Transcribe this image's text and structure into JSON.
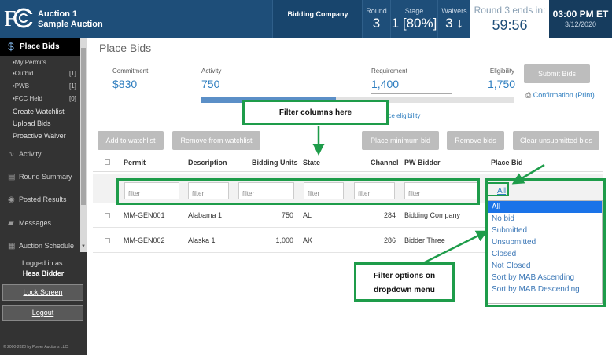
{
  "header": {
    "logo_text": "FCC",
    "auction_line1": "Auction 1",
    "auction_line2": "Sample Auction",
    "company": "Bidding Company",
    "round_label": "Round",
    "round_value": "3",
    "stage_label": "Stage",
    "stage_value": "1 [80%]",
    "waivers_label": "Waivers",
    "waivers_value": "3 ↓",
    "round_ends_label": "Round 3 ends in:",
    "round_ends_value": "59:56",
    "clock_time": "03:00 PM ET",
    "clock_date": "3/12/2020"
  },
  "sidebar": {
    "active_label": "Place Bids",
    "sub_items": [
      {
        "label": "•My Permits",
        "count": ""
      },
      {
        "label": "•Outbid",
        "count": "[1]"
      },
      {
        "label": "•PWB",
        "count": "[1]"
      },
      {
        "label": "•FCC Held",
        "count": "[0]"
      }
    ],
    "links": [
      "Create Watchlist",
      "Upload Bids",
      "Proactive Waiver"
    ],
    "items": [
      "Activity",
      "Round Summary",
      "Posted Results",
      "Messages",
      "Auction Schedule"
    ],
    "logged_in_label": "Logged in as:",
    "user_name": "Hesa Bidder",
    "lock_label": "Lock Screen",
    "logout_label": "Logout",
    "copyright": "© 2000-2020 by Power Auctions LLC."
  },
  "main": {
    "title": "Place Bids",
    "commitment_label": "Commitment",
    "commitment_value": "$830",
    "activity_label": "Activity",
    "activity_value": "750",
    "requirement_label": "Requirement",
    "requirement_value": "1,400",
    "eligibility_label": "Eligibility",
    "eligibility_value": "1,750",
    "activity_fraction": 0.43,
    "submit_label": "Submit Bids",
    "confirmation_label": "Confirmation",
    "print_label": "(Print)",
    "reduce_label": "uce eligibility",
    "buttons": {
      "add_watchlist": "Add to watchlist",
      "remove_watchlist": "Remove from watchlist",
      "place_min": "Place minimum bid",
      "remove_bids": "Remove bids",
      "clear_unsubmitted": "Clear unsubmitted bids"
    }
  },
  "table": {
    "columns": [
      "Permit",
      "Description",
      "Bidding Units",
      "State",
      "Channel",
      "PW Bidder",
      "Place Bid"
    ],
    "filter_placeholder": "filter",
    "filter_all": "All",
    "rows": [
      {
        "permit": "MM-GEN001",
        "description": "Alabama 1",
        "units": "750",
        "state": "AL",
        "channel": "284",
        "bidder": "Bidding Company"
      },
      {
        "permit": "MM-GEN002",
        "description": "Alaska 1",
        "units": "1,000",
        "state": "AK",
        "channel": "286",
        "bidder": "Bidder Three"
      }
    ]
  },
  "dropdown": {
    "options": [
      "All",
      "No bid",
      "Submitted",
      "Unsubmitted",
      "Closed",
      "Not Closed",
      "Sort by MAB Ascending",
      "Sort by MAB Descending"
    ],
    "selected": "All"
  },
  "annotations": {
    "filter_columns": "Filter columns here",
    "filter_options_line1": "Filter options on",
    "filter_options_line2": "dropdown menu"
  },
  "colors": {
    "header_bg": "#1e4e79",
    "sidebar_bg": "#333333",
    "accent_blue": "#2d7dbf",
    "annotation_green": "#1e9c4a"
  }
}
